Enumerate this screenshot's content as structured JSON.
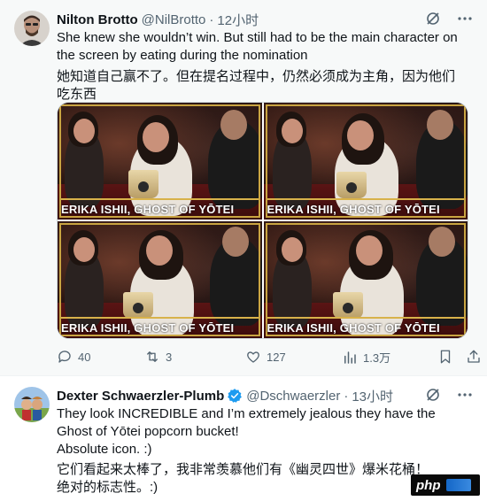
{
  "tweet1": {
    "author_name": "Nilton Brotto",
    "handle": "@NilBrotto",
    "separator": "·",
    "time": "12小时",
    "text_en": "She knew she wouldn’t win. But still had to be the main character on the screen by eating during the nomination",
    "text_zh": "她知道自己赢不了。但在提名过程中，仍然必须成为主角，因为他们吃东西",
    "media": {
      "captions": [
        "ERIKA ISHII, GHOST OF YŌTEI",
        "ERIKA ISHII, GHOST OF YŌTEI",
        "ERIKA ISHII, GHOST OF YŌTEI",
        "ERIKA ISHII, GHOST OF YŌTEI"
      ]
    },
    "actions": {
      "replies": "40",
      "reposts": "3",
      "likes": "127",
      "views": "1.3万"
    }
  },
  "tweet2": {
    "author_name": "Dexter Schwaerzler-Plumb",
    "handle": "@Dschwaerzler",
    "separator": "·",
    "time": "13小时",
    "text_en_line1": "They look INCREDIBLE and I’m extremely jealous they have the Ghost of Yōtei popcorn bucket!",
    "text_en_line2": "Absolute icon. :)",
    "text_zh_line1": "它们看起来太棒了，我非常羡慕他们有《幽灵四世》爆米花桶！",
    "text_zh_line2": "绝对的标志性。:)"
  },
  "watermark": {
    "text": "php"
  },
  "colors": {
    "text_primary": "#0f1419",
    "text_secondary": "#536471",
    "verified_blue": "#1d9bf0",
    "caption_gold": "#c9a441"
  }
}
